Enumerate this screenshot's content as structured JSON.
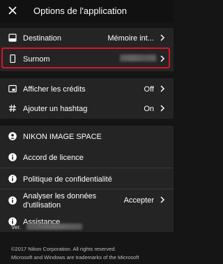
{
  "header": {
    "title": "Options de l'application",
    "close_icon": "close-icon"
  },
  "camera_section": {
    "destination": {
      "label": "Destination",
      "value": "Mémoire int..."
    },
    "nickname": {
      "label": "Surnom"
    }
  },
  "share_section": {
    "credits": {
      "label": "Afficher les crédits",
      "value": "Off"
    },
    "hashtag": {
      "label": "Ajouter un hashtag",
      "value": "On"
    }
  },
  "info_section": {
    "nikon_image_space": "NIKON IMAGE SPACE",
    "license": "Accord de licence",
    "privacy": "Politique de confidentialité",
    "analytics": {
      "label_line1": "Analyser les données",
      "label_line2": "d'utilisation",
      "value": "Accepter"
    },
    "support": "Assistance"
  },
  "footer": {
    "version_label": "Ver.",
    "copyright_line1": "©2017 Nikon Corporation. All rights reserved.",
    "copyright_line2": "Microsoft and Windows are trademarks of the Microsoft"
  },
  "colors": {
    "highlight": "#d8142a",
    "background": "#151515",
    "group_bg": "#242424"
  }
}
